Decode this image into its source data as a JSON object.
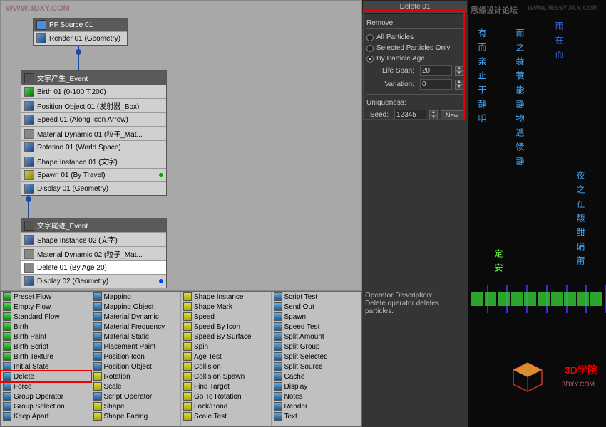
{
  "watermarks": {
    "tl": "WWW.3DXY.COM",
    "tr": "思缘设计论坛",
    "tr2": "WWW.MISSYUAN.COM"
  },
  "nodes": {
    "source": {
      "title": "PF Source 01",
      "rows": [
        "Render 01 (Geometry)"
      ]
    },
    "event1": {
      "title": "文字产生_Event",
      "rows": [
        "Birth 01 (0-100 T:200)",
        "Position Object 01 (发射器_Box)",
        "Speed 01 (Along Icon Arrow)",
        "Material Dynamic 01 (粒子_Mat...",
        "Rotation 01 (World Space)",
        "Shape Instance 01 (文字)",
        "Spawn 01 (By Travel)",
        "Display 01 (Geometry)"
      ]
    },
    "event2": {
      "title": "文字尾迹_Event",
      "rows": [
        "Shape Instance 02 (文字)",
        "Material Dynamic 02 (粒子_Mat...",
        "Delete 01 (By Age 20)",
        "Display 02 (Geometry)"
      ]
    }
  },
  "palette": {
    "col1": [
      "Preset Flow",
      "Empty Flow",
      "Standard Flow",
      "Birth",
      "Birth Paint",
      "Birth Script",
      "Birth Texture",
      "Initial State",
      "Delete",
      "Force",
      "Group Operator",
      "Group Selection",
      "Keep Apart"
    ],
    "col2": [
      "Mapping",
      "Mapping Object",
      "Material Dynamic",
      "Material Frequency",
      "Material Static",
      "Placement Paint",
      "Position Icon",
      "Position Object",
      "Rotation",
      "Scale",
      "Script Operator",
      "Shape",
      "Shape Facing"
    ],
    "col3": [
      "Shape Instance",
      "Shape Mark",
      "Speed",
      "Speed By Icon",
      "Speed By Surface",
      "Spin",
      "Age Test",
      "Collision",
      "Collision Spawn",
      "Find Target",
      "Go To Rotation",
      "Lock/Bond",
      "Scale Test"
    ],
    "col4": [
      "Script Test",
      "Send Out",
      "Spawn",
      "Speed Test",
      "Split Amount",
      "Split Group",
      "Split Selected",
      "Split Source",
      "Cache",
      "Display",
      "Notes",
      "Render",
      "Text"
    ]
  },
  "panel": {
    "title": "Delete 01",
    "section": "Remove:",
    "opt1": "All Particles",
    "opt2": "Selected Particles Only",
    "opt3": "By Particle Age",
    "lifespan_label": "Life Span:",
    "lifespan": "20",
    "variation_label": "Variation:",
    "variation": "0",
    "unique": "Uniqueness:",
    "seed_label": "Seed:",
    "seed": "12345",
    "new": "New",
    "desc_title": "Operator Description:",
    "desc": "Delete operator deletes particles."
  },
  "viewport": {
    "cols": [
      "有而亲止于静明",
      "而之蓑蓑能静物遁馈静",
      "雨在而",
      "夜之在馥酣硝莆"
    ],
    "green": "定安",
    "logo": "3D学院",
    "logo_sub": "3DXY.COM"
  }
}
